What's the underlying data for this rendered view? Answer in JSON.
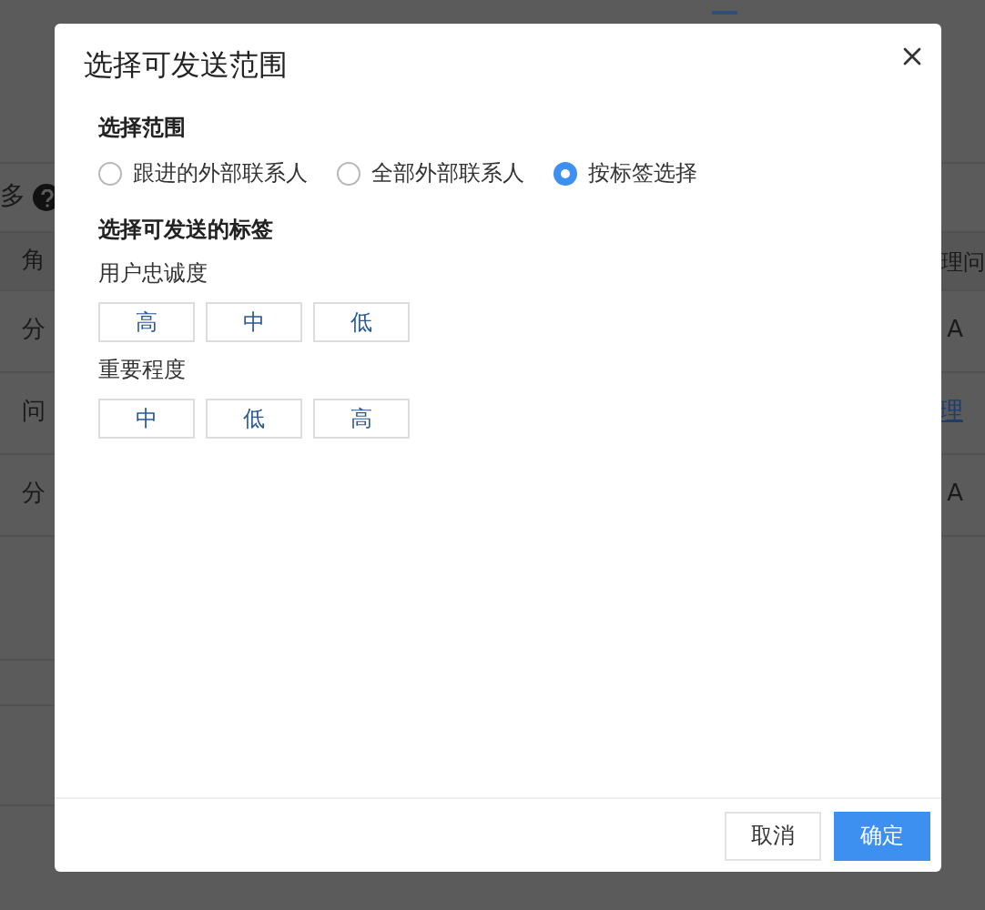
{
  "background": {
    "help_label": "多",
    "rows": [
      {
        "kind": "header",
        "left": "角",
        "right": "理问"
      },
      {
        "kind": "text",
        "left": "分",
        "right": "A"
      },
      {
        "kind": "link",
        "left": "问",
        "right": "理"
      },
      {
        "kind": "text",
        "left": "分",
        "right": "A"
      }
    ]
  },
  "dialog": {
    "title": "选择可发送范围",
    "scope": {
      "label": "选择范围",
      "options": [
        {
          "label": "跟进的外部联系人",
          "selected": false
        },
        {
          "label": "全部外部联系人",
          "selected": false
        },
        {
          "label": "按标签选择",
          "selected": true
        }
      ]
    },
    "tags": {
      "label": "选择可发送的标签",
      "groups": [
        {
          "name": "用户忠诚度",
          "tags": [
            "高",
            "中",
            "低"
          ]
        },
        {
          "name": "重要程度",
          "tags": [
            "中",
            "低",
            "高"
          ]
        }
      ]
    },
    "buttons": [
      {
        "kind": "secondary",
        "label": "取消"
      },
      {
        "kind": "primary",
        "label": "确定"
      }
    ]
  }
}
